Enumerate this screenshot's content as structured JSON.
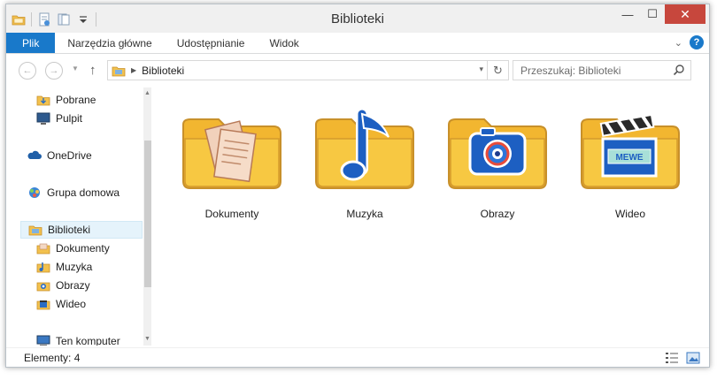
{
  "window": {
    "title": "Biblioteki"
  },
  "window_controls": {
    "minimize": "—",
    "maximize": "☐",
    "close": "✕"
  },
  "ribbon": {
    "tabs": [
      "Plik",
      "Narzędzia główne",
      "Udostępnianie",
      "Widok"
    ],
    "help": "?"
  },
  "address": {
    "crumb": "Biblioteki",
    "back_symbol": "←",
    "forward_symbol": "→",
    "up_symbol": "↑",
    "recent_symbol": "▼",
    "dropdown_symbol": "▾",
    "refresh_symbol": "↻",
    "search_placeholder": "Przeszukaj: Biblioteki"
  },
  "nav": {
    "items": [
      {
        "label": "Pobrane",
        "icon": "downloads-folder-icon"
      },
      {
        "label": "Pulpit",
        "icon": "desktop-icon"
      },
      {
        "label": "OneDrive",
        "icon": "cloud-icon"
      },
      {
        "label": "Grupa domowa",
        "icon": "homegroup-icon"
      },
      {
        "label": "Biblioteki",
        "icon": "libraries-icon",
        "selected": true
      },
      {
        "label": "Dokumenty",
        "icon": "documents-library-icon"
      },
      {
        "label": "Muzyka",
        "icon": "music-library-icon"
      },
      {
        "label": "Obrazy",
        "icon": "pictures-library-icon"
      },
      {
        "label": "Wideo",
        "icon": "videos-library-icon"
      },
      {
        "label": "Ten komputer",
        "icon": "computer-icon"
      }
    ]
  },
  "libraries": [
    {
      "label": "Dokumenty",
      "icon": "documents-folder-icon"
    },
    {
      "label": "Muzyka",
      "icon": "music-note-folder-icon"
    },
    {
      "label": "Obrazy",
      "icon": "camera-folder-icon"
    },
    {
      "label": "Wideo",
      "icon": "clapperboard-folder-icon",
      "badge": "MEWE"
    }
  ],
  "status": {
    "text": "Elementy: 4"
  },
  "colors": {
    "accent": "#1979ca",
    "close_button": "#c7473d",
    "folder": "#f2b630",
    "selection": "#e5f3fb"
  }
}
